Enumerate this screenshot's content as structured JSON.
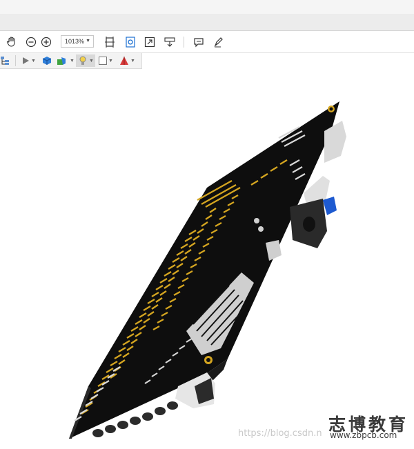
{
  "toolbar": {
    "zoom_value": "1013%",
    "icons": [
      "hand-icon",
      "zoom-out-icon",
      "zoom-in-icon",
      "zoom-dropdown",
      "fit-page-icon",
      "rotate-icon",
      "fullscreen-icon",
      "scroll-mode-icon",
      "comment-icon",
      "pen-icon"
    ]
  },
  "toolbar_3d": {
    "icons": [
      "model-tree-icon",
      "play-icon",
      "cube-view-icon",
      "render-mode-icon",
      "lighting-icon",
      "background-icon",
      "cross-section-icon"
    ]
  },
  "viewport": {
    "content": "3D model of circuit board (PCB)"
  },
  "watermark": {
    "chinese": "志博教育",
    "url": "www.zbpcb.com",
    "csdn": "https://blog.csdn.n"
  },
  "colors": {
    "pcb": "#111111",
    "gold": "#d4a520",
    "silver": "#c8c8c8",
    "blue": "#1e5ad0"
  }
}
